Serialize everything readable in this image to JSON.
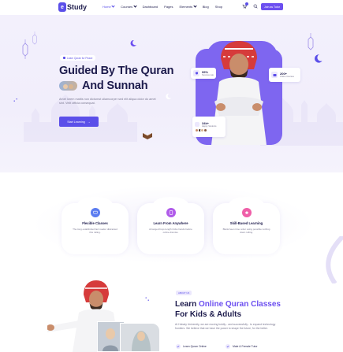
{
  "header": {
    "logo_text": "Study",
    "logo_mark": "e",
    "nav": [
      {
        "label": "Home",
        "active": true,
        "dropdown": true
      },
      {
        "label": "Courses",
        "active": false,
        "dropdown": true
      },
      {
        "label": "Dashboard",
        "active": false,
        "dropdown": false
      },
      {
        "label": "Pages",
        "active": false,
        "dropdown": false
      },
      {
        "label": "Elements",
        "active": false,
        "dropdown": true
      },
      {
        "label": "Blog",
        "active": false,
        "dropdown": false
      },
      {
        "label": "Shop",
        "active": false,
        "dropdown": false
      }
    ],
    "cart_icon": "cart-icon",
    "search_icon": "search-icon",
    "join_label": "Join as Tutor"
  },
  "hero": {
    "badge": "Learn Quran for Peace",
    "title_line1": "Guided By The Quran",
    "title_line2": "And Sunnah",
    "description": "Amet lorem mattis non dictumst ullamcorper sed elit aliqua dolor do amet sint. Velit officia consequat.",
    "cta_label": "Start Learning",
    "cta_arrow": "→",
    "stats": [
      {
        "value": "99%",
        "label": "Success rate"
      },
      {
        "value": "200+",
        "label": "Online Courses"
      },
      {
        "value": "34k+",
        "label": "Happy Students"
      }
    ]
  },
  "features": [
    {
      "title": "Flexible Classes",
      "description": "The long established fact reader distracted this rolling.",
      "icon": "monitor-icon",
      "color": "#5b7cf0"
    },
    {
      "title": "Learn From Anywhere",
      "description": "Arranged buys length tricks hands before online dismiss.",
      "icon": "globe-icon",
      "color": "#b05bea"
    },
    {
      "title": "Skill-Based Learning",
      "description": "Blank been time order using possible nothing down rolling.",
      "icon": "star-icon",
      "color": "#ef5fa8"
    }
  ],
  "about": {
    "tag": "ABOUT US",
    "title_prefix": "Learn ",
    "title_highlight": "Online Quran Classes",
    "title_line2": "For Kids & Adults",
    "description": "At Hobaty University, we are moving boldly - and successfully - to expand technology frontiers. We believe that we have the power to shape the future, for the better.",
    "bullets": [
      "Learn Quran Online",
      "Male & Female Tutor"
    ]
  },
  "colors": {
    "brand": "#5b4fe9",
    "accent": "#6c4ff0",
    "text": "#1d1b4c",
    "muted": "#7a7891"
  }
}
